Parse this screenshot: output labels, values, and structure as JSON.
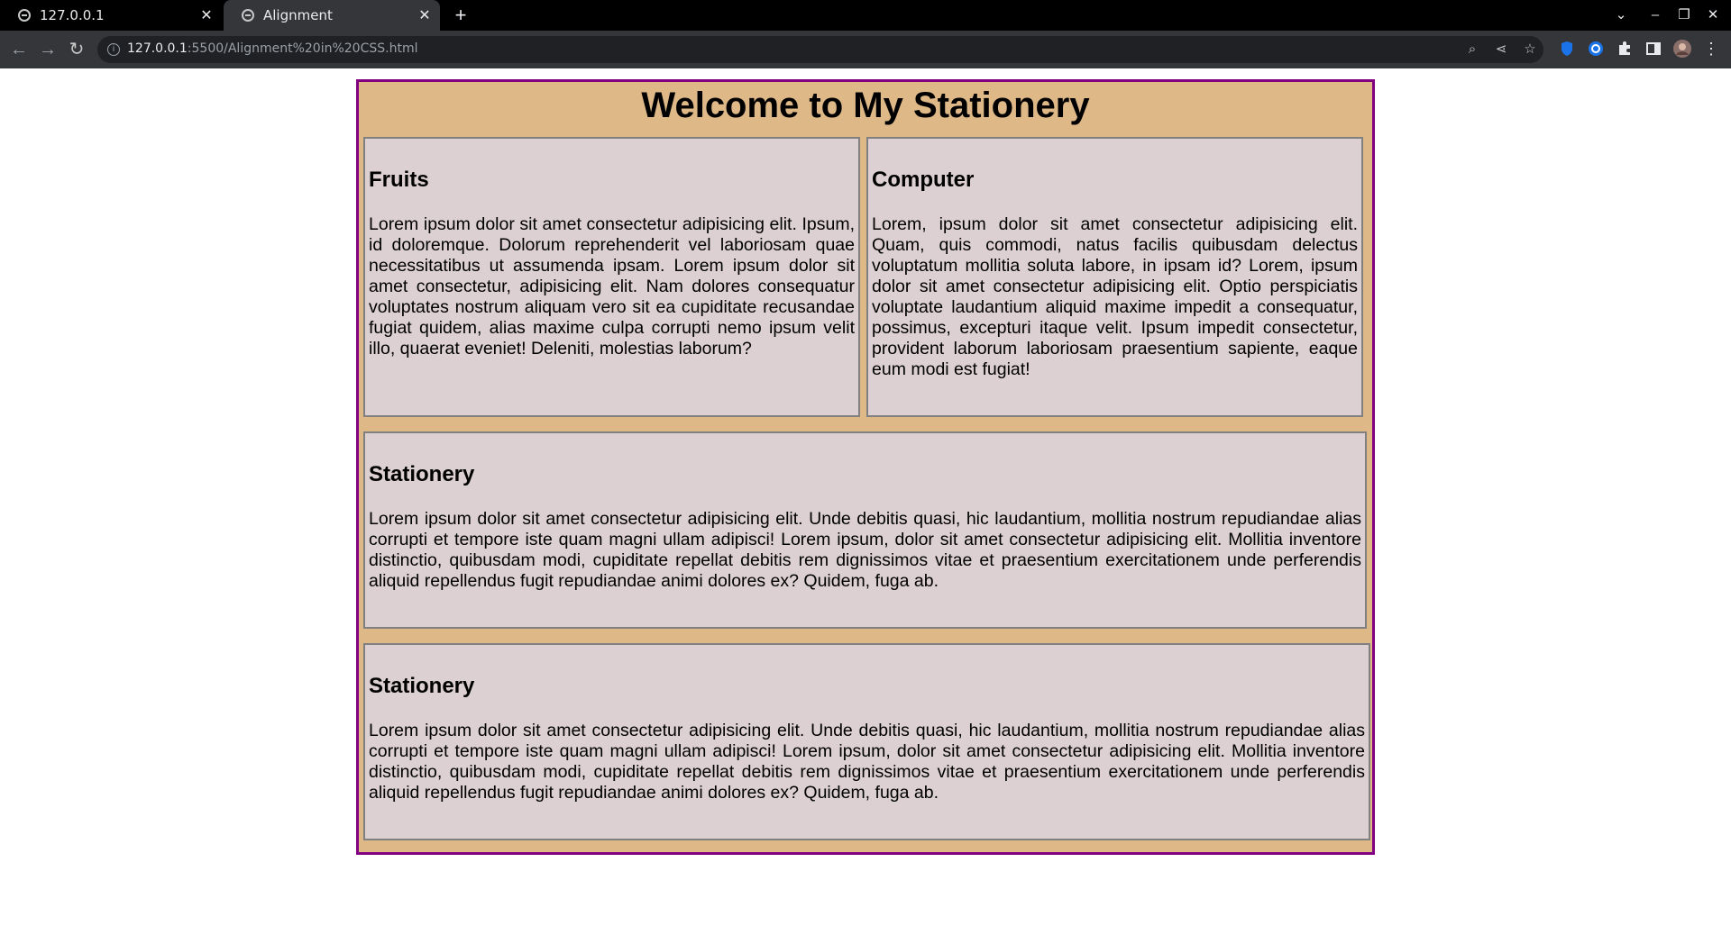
{
  "browser": {
    "tabs": [
      {
        "title": "127.0.0.1",
        "active": false
      },
      {
        "title": "Alignment",
        "active": true
      }
    ],
    "new_tab_label": "+",
    "url_host": "127.0.0.1",
    "url_rest": ":5500/Alignment%20in%20CSS.html"
  },
  "page": {
    "title": "Welcome to My Stationery",
    "cards": [
      {
        "heading": "Fruits",
        "text": "Lorem ipsum dolor sit amet consectetur adipisicing elit. Ipsum, id doloremque. Dolorum reprehenderit vel laboriosam quae necessitatibus ut assumenda ipsam. Lorem ipsum dolor sit amet consectetur, adipisicing elit. Nam dolores consequatur voluptates nostrum aliquam vero sit ea cupiditate recusandae fugiat quidem, alias maxime culpa corrupti nemo ipsum velit illo, quaerat eveniet! Deleniti, molestias laborum?"
      },
      {
        "heading": "Computer",
        "text": "Lorem, ipsum dolor sit amet consectetur adipisicing elit. Quam, quis commodi, natus facilis quibusdam delectus voluptatum mollitia soluta labore, in ipsam id? Lorem, ipsum dolor sit amet consectetur adipisicing elit. Optio perspiciatis voluptate laudantium aliquid maxime impedit a consequatur, possimus, excepturi itaque velit. Ipsum impedit consectetur, provident laborum laboriosam praesentium sapiente, eaque eum modi est fugiat!"
      },
      {
        "heading": "Stationery",
        "text": "Lorem ipsum dolor sit amet consectetur adipisicing elit. Unde debitis quasi, hic laudantium, mollitia nostrum repudiandae alias corrupti et tempore iste quam magni ullam adipisci! Lorem ipsum, dolor sit amet consectetur adipisicing elit. Mollitia inventore distinctio, quibusdam modi, cupiditate repellat debitis rem dignissimos vitae et praesentium exercitationem unde perferendis aliquid repellendus fugit repudiandae animi dolores ex? Quidem, fuga ab."
      },
      {
        "heading": "Stationery",
        "text": "Lorem ipsum dolor sit amet consectetur adipisicing elit. Unde debitis quasi, hic laudantium, mollitia nostrum repudiandae alias corrupti et tempore iste quam magni ullam adipisci! Lorem ipsum, dolor sit amet consectetur adipisicing elit. Mollitia inventore distinctio, quibusdam modi, cupiditate repellat debitis rem dignissimos vitae et praesentium exercitationem unde perferendis aliquid repellendus fugit repudiandae animi dolores ex? Quidem, fuga ab."
      }
    ]
  },
  "colors": {
    "container_bg": "#deb887",
    "container_border": "#800080",
    "card_bg": "#dcd0d2",
    "card_border": "#808080"
  },
  "icons": [
    "globe-icon",
    "close-icon",
    "plus-icon",
    "back-icon",
    "forward-icon",
    "reload-icon",
    "info-icon",
    "zoom-icon",
    "share-icon",
    "star-icon",
    "shield-extension-icon",
    "circle-extension-icon",
    "puzzle-icon",
    "side-panel-icon",
    "avatar",
    "menu-icon",
    "chevron-down-icon",
    "minimize-icon",
    "restore-icon"
  ]
}
